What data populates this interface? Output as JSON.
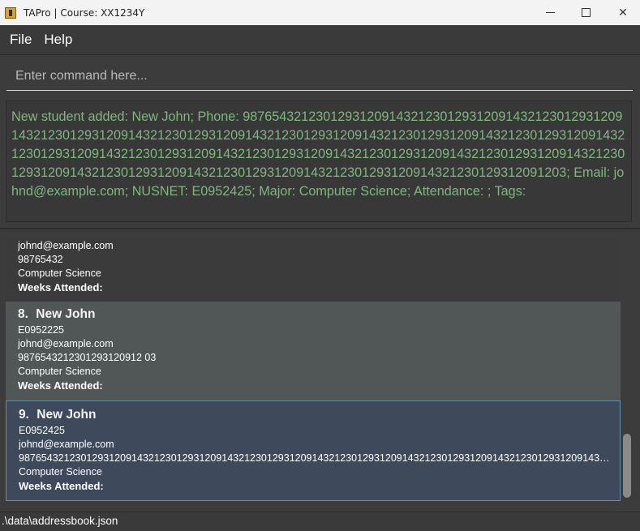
{
  "window": {
    "title": "TAPro | Course: XX1234Y",
    "icons": {
      "app": "tapro-app-icon",
      "minimize": "minimize-icon",
      "maximize": "maximize-icon",
      "close": "close-icon"
    },
    "close_glyph": "✕"
  },
  "menu": {
    "file_label": "File",
    "help_label": "Help"
  },
  "command": {
    "placeholder": "Enter command here...",
    "value": ""
  },
  "result": {
    "text": "New student added: New John; Phone: 98765432123012931209143212301293120914321230129312091432123012931209143212301293120914321230129312091432123012931209143212301293120914321230129312091432123012931209143212301293120914321230129312091432123012931209143212301293120914321230129312091432123012931209143212301293120914321230129312091203; Email: johnd@example.com; NUSNET: E0952425; Major: Computer Science; Attendance: ; Tags:"
  },
  "students": {
    "partial": {
      "email": "johnd@example.com",
      "phone": "98765432",
      "major": "Computer Science",
      "weeks_label": "Weeks Attended:"
    },
    "card8": {
      "index": "8.",
      "name": "New John",
      "nusnet": "E0952225",
      "email": "johnd@example.com",
      "phone": "9876543212301293120912 03",
      "major": "Computer Science",
      "weeks_label": "Weeks Attended:"
    },
    "card9": {
      "index": "9.",
      "name": "New John",
      "nusnet": "E0952425",
      "email": "johnd@example.com",
      "phone": "98765432123012931209143212301293120914321230129312091432123012931209143212301293120914321230129312091432123012931209143...",
      "major": "Computer Science",
      "weeks_label": "Weeks Attended:"
    }
  },
  "status": {
    "file_path": ".\\data\\addressbook.json"
  },
  "colors": {
    "background": "#3c3c3c",
    "result_text": "#7fb77e",
    "selected_card": "#3e4a5c",
    "selected_border": "#5a8fb6",
    "alt_card": "#515657"
  }
}
